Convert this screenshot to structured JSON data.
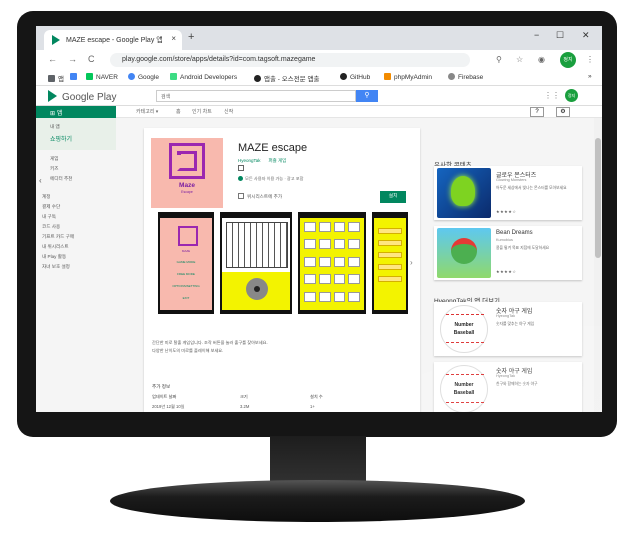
{
  "browser": {
    "tab_title": "MAZE escape - Google Play 앱",
    "tab_close": "×",
    "new_tab": "+",
    "win_min": "−",
    "win_max": "☐",
    "win_close": "✕",
    "back": "←",
    "forward": "→",
    "reload": "C",
    "url": "play.google.com/store/apps/details?id=com.tagsoft.mazegame",
    "profile": "정지",
    "bookmarks": [
      {
        "label": "앱",
        "color": "#5f6368"
      },
      {
        "label": "",
        "color": "#4285f4"
      },
      {
        "label": "NAVER",
        "color": "#03c75a"
      },
      {
        "label": "Google",
        "color": "#4285f4"
      },
      {
        "label": "Android Developers",
        "color": "#3ddc84"
      },
      {
        "label": "앱출 - 오스전문 앱출",
        "color": "#222222"
      },
      {
        "label": "GitHub",
        "color": "#222222"
      },
      {
        "label": "phpMyAdmin",
        "color": "#f28b00"
      },
      {
        "label": "Firebase",
        "color": "#888888"
      }
    ],
    "more": "»"
  },
  "play": {
    "logo": "Google Play",
    "search_placeholder": "검색",
    "search_btn": "⚲",
    "app_tab": "앱",
    "subnav": [
      "카테고리 ▾",
      "홈",
      "인기 차트",
      "신작"
    ],
    "help": "?",
    "settings": "⚙",
    "avatar": "정지"
  },
  "sidebar": {
    "items": [
      "내 앱",
      "쇼핑하기",
      "게임",
      "키즈",
      "에디터 추천",
      "계정",
      "결제 수단",
      "내 구독",
      "코드 사용",
      "기프트 카드 구매",
      "내 위시리스트",
      "내 Play 활동",
      "자녀 보호 설정"
    ],
    "chevron": "‹"
  },
  "app": {
    "title": "MAZE escape",
    "developer": "HyeongTak",
    "category": "퍼즐 게임",
    "icon_title": "Maze",
    "icon_sub": "Escape",
    "notice": "모든 사용자 이용 가능 · 광고 포함",
    "wishlist": "위시리스트에 추가",
    "install": "설치",
    "ss_menu": [
      "MAZE",
      "GAME MODE",
      "FREE MODE",
      "OPTIONS/SETTING",
      "EXIT"
    ],
    "desc1": "간단한 미로 탈출 게임입니다. 조작 버튼을 눌러 출구를 찾아보세요.",
    "desc2": "다양한 난이도의 미로를 플레이해 보세요.",
    "extra_header": "추가 정보",
    "labels": [
      "업데이트 날짜",
      "크기",
      "설치 수"
    ],
    "values": [
      "2019년 12월 10일",
      "3.2M",
      "1+"
    ]
  },
  "related": {
    "similar_header": "유사한 콘텐츠",
    "dev_header": "HyeongTak의 앱 더보기",
    "items": [
      {
        "title": "글로우 몬스터즈",
        "dev": "Glowing Monsters",
        "desc": "어두운 세상에서 빛나는 몬스터를 모아보세요"
      },
      {
        "title": "Bean Dreams",
        "dev": "Kumobius",
        "desc": "콩을 튕겨 목표 지점에 도달하세요"
      },
      {
        "title": "숫자 야구 게임",
        "dev": "HyeongTak",
        "desc": "숫자를 맞추는 야구 게임"
      },
      {
        "title": "숫자 야구 게임",
        "dev": "HyeongTak",
        "desc": "친구와 함께하는 숫자 야구"
      }
    ],
    "ball_text1": "Number",
    "ball_text2": "Baseball"
  }
}
